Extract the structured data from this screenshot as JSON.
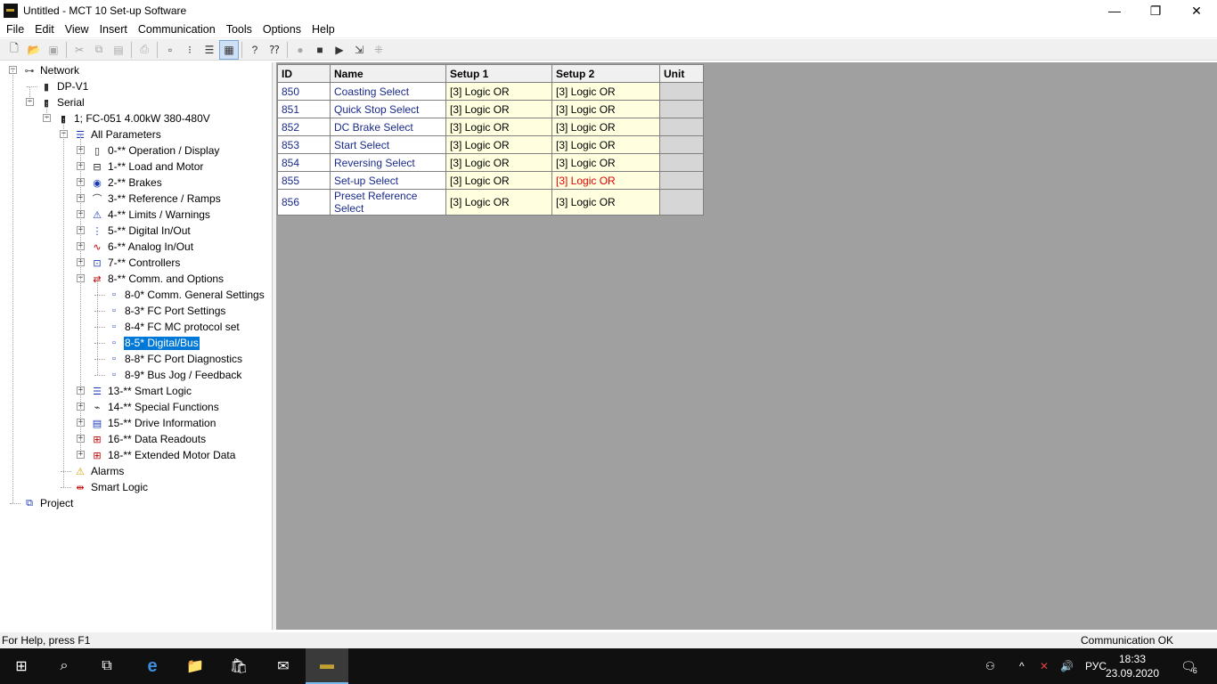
{
  "window": {
    "title": "Untitled - MCT 10 Set-up Software",
    "minimize_glyph": "—",
    "restore_glyph": "❐",
    "close_glyph": "✕"
  },
  "menu": [
    "File",
    "Edit",
    "View",
    "Insert",
    "Communication",
    "Tools",
    "Options",
    "Help"
  ],
  "toolbar": [
    {
      "icon": "new-file-icon",
      "glyph": "🗋",
      "disabled": false
    },
    {
      "icon": "open-folder-icon",
      "glyph": "📂",
      "disabled": false
    },
    {
      "icon": "save-icon",
      "glyph": "▣",
      "disabled": true
    },
    {
      "sep": true
    },
    {
      "icon": "cut-icon",
      "glyph": "✂",
      "disabled": true
    },
    {
      "icon": "copy-icon",
      "glyph": "⧉",
      "disabled": true
    },
    {
      "icon": "paste-icon",
      "glyph": "▤",
      "disabled": true
    },
    {
      "sep": true
    },
    {
      "icon": "print-icon",
      "glyph": "⎙",
      "disabled": true
    },
    {
      "sep": true
    },
    {
      "icon": "large-icons-view-icon",
      "glyph": "▫",
      "disabled": false
    },
    {
      "icon": "small-icons-view-icon",
      "glyph": "⁝",
      "disabled": false
    },
    {
      "icon": "list-view-icon",
      "glyph": "☰",
      "disabled": false
    },
    {
      "icon": "details-view-icon",
      "glyph": "▦",
      "disabled": false,
      "pressed": true
    },
    {
      "sep": true
    },
    {
      "icon": "help-icon",
      "glyph": "?",
      "disabled": false
    },
    {
      "icon": "context-help-icon",
      "glyph": "⁇",
      "disabled": false
    },
    {
      "sep": true
    },
    {
      "icon": "stop-icon",
      "glyph": "●",
      "disabled": true
    },
    {
      "icon": "drive-stop-icon",
      "glyph": "■",
      "disabled": false
    },
    {
      "icon": "drive-start-icon",
      "glyph": "▶",
      "disabled": false
    },
    {
      "icon": "read-from-drive-icon",
      "glyph": "⇲",
      "disabled": false
    },
    {
      "icon": "scan-network-icon",
      "glyph": "⁜",
      "disabled": true
    }
  ],
  "tree": [
    {
      "label": "Network",
      "level": 0,
      "icon": "network-icon",
      "glyph": "⊶",
      "color": "#555",
      "expander": "−"
    },
    {
      "label": "DP-V1",
      "level": 1,
      "icon": "drive-icon",
      "glyph": "▮",
      "color": "#333",
      "expander": ""
    },
    {
      "label": "Serial",
      "level": 1,
      "icon": "drive-icon",
      "glyph": "▮",
      "color": "#333",
      "expander": "−"
    },
    {
      "label": "1; FC-051 4.00kW 380-480V",
      "level": 2,
      "icon": "drive-icon",
      "glyph": "▮",
      "color": "#222",
      "expander": "−"
    },
    {
      "label": "All Parameters",
      "level": 3,
      "icon": "parameter-list-icon",
      "glyph": "☰",
      "color": "#1a3ab8",
      "expander": "−"
    },
    {
      "label": "0-** Operation / Display",
      "level": 4,
      "icon": "display-icon",
      "glyph": "▯",
      "color": "#222",
      "expander": "+"
    },
    {
      "label": "1-** Load and Motor",
      "level": 4,
      "icon": "motor-icon",
      "glyph": "⊟",
      "color": "#222",
      "expander": "+"
    },
    {
      "label": "2-** Brakes",
      "level": 4,
      "icon": "brake-icon",
      "glyph": "◉",
      "color": "#1a3ab8",
      "expander": "+"
    },
    {
      "label": "3-** Reference / Ramps",
      "level": 4,
      "icon": "ramp-icon",
      "glyph": "⌒",
      "color": "#333",
      "expander": "+"
    },
    {
      "label": "4-** Limits / Warnings",
      "level": 4,
      "icon": "limits-icon",
      "glyph": "⚠",
      "color": "#1a3ab8",
      "expander": "+"
    },
    {
      "label": "5-** Digital In/Out",
      "level": 4,
      "icon": "digital-io-icon",
      "glyph": "⋮",
      "color": "#1a3ab8",
      "expander": "+"
    },
    {
      "label": "6-** Analog In/Out",
      "level": 4,
      "icon": "analog-io-icon",
      "glyph": "∿",
      "color": "#c00000",
      "expander": "+"
    },
    {
      "label": "7-** Controllers",
      "level": 4,
      "icon": "controller-icon",
      "glyph": "⊡",
      "color": "#1a3ab8",
      "expander": "+"
    },
    {
      "label": "8-** Comm. and Options",
      "level": 4,
      "icon": "comm-icon",
      "glyph": "⇄",
      "color": "#c00000",
      "expander": "−"
    },
    {
      "label": "8-0* Comm. General Settings",
      "level": 5,
      "icon": "param-group-icon",
      "glyph": "▫",
      "color": "#1a3ab8",
      "expander": ""
    },
    {
      "label": "8-3* FC Port Settings",
      "level": 5,
      "icon": "param-group-icon",
      "glyph": "▫",
      "color": "#1a3ab8",
      "expander": ""
    },
    {
      "label": "8-4* FC MC protocol set",
      "level": 5,
      "icon": "param-group-icon",
      "glyph": "▫",
      "color": "#1a3ab8",
      "expander": ""
    },
    {
      "label": "8-5* Digital/Bus",
      "level": 5,
      "icon": "param-group-icon",
      "glyph": "▫",
      "color": "#1a3ab8",
      "expander": "",
      "selected": true
    },
    {
      "label": "8-8* FC Port Diagnostics",
      "level": 5,
      "icon": "param-group-icon",
      "glyph": "▫",
      "color": "#1a3ab8",
      "expander": ""
    },
    {
      "label": "8-9* Bus Jog / Feedback",
      "level": 5,
      "icon": "param-group-icon",
      "glyph": "▫",
      "color": "#1a3ab8",
      "expander": ""
    },
    {
      "label": "13-** Smart Logic",
      "level": 4,
      "icon": "smart-logic-icon",
      "glyph": "☰",
      "color": "#1a3ab8",
      "expander": "+"
    },
    {
      "label": "14-** Special Functions",
      "level": 4,
      "icon": "special-functions-icon",
      "glyph": "⌁",
      "color": "#333",
      "expander": "+"
    },
    {
      "label": "15-** Drive Information",
      "level": 4,
      "icon": "drive-info-icon",
      "glyph": "▤",
      "color": "#1a3ab8",
      "expander": "+"
    },
    {
      "label": "16-** Data Readouts",
      "level": 4,
      "icon": "data-readouts-icon",
      "glyph": "⊞",
      "color": "#c00000",
      "expander": "+"
    },
    {
      "label": "18-** Extended Motor Data",
      "level": 4,
      "icon": "extended-motor-icon",
      "glyph": "⊞",
      "color": "#c00000",
      "expander": "+"
    },
    {
      "label": "Alarms",
      "level": 3,
      "icon": "alarm-icon",
      "glyph": "⚠",
      "color": "#d4a000",
      "expander": ""
    },
    {
      "label": "Smart Logic",
      "level": 3,
      "icon": "smart-logic-icon",
      "glyph": "⇹",
      "color": "#c00000",
      "expander": ""
    },
    {
      "label": "Project",
      "level": 0,
      "icon": "project-icon",
      "glyph": "⧉",
      "color": "#1a3ab8",
      "expander": ""
    }
  ],
  "grid": {
    "columns": [
      "ID",
      "Name",
      "Setup 1",
      "Setup 2",
      "Unit"
    ],
    "rows": [
      {
        "id": "850",
        "name": "Coasting Select",
        "setup1": "[3] Logic OR",
        "setup2": "[3] Logic OR",
        "unit": "",
        "differs": false
      },
      {
        "id": "851",
        "name": "Quick Stop Select",
        "setup1": "[3] Logic OR",
        "setup2": "[3] Logic OR",
        "unit": "",
        "differs": false
      },
      {
        "id": "852",
        "name": "DC Brake Select",
        "setup1": "[3] Logic OR",
        "setup2": "[3] Logic OR",
        "unit": "",
        "differs": false
      },
      {
        "id": "853",
        "name": "Start Select",
        "setup1": "[3] Logic OR",
        "setup2": "[3] Logic OR",
        "unit": "",
        "differs": false
      },
      {
        "id": "854",
        "name": "Reversing Select",
        "setup1": "[3] Logic OR",
        "setup2": "[3] Logic OR",
        "unit": "",
        "differs": false
      },
      {
        "id": "855",
        "name": "Set-up Select",
        "setup1": "[3] Logic OR",
        "setup2": "[3] Logic OR",
        "unit": "",
        "differs": true
      },
      {
        "id": "856",
        "name": "Preset Reference Select",
        "setup1": "[3] Logic OR",
        "setup2": "[3] Logic OR",
        "unit": "",
        "differs": false
      }
    ]
  },
  "status": {
    "help": "For Help, press F1",
    "communication": "Communication OK"
  },
  "taskbar": {
    "apps": [
      {
        "icon": "windows-start-icon",
        "glyph": "⊞"
      },
      {
        "icon": "search-icon",
        "glyph": "⌕"
      },
      {
        "icon": "task-view-icon",
        "glyph": "⧉"
      },
      {
        "icon": "edge-browser-icon",
        "glyph": "e"
      },
      {
        "icon": "file-explorer-icon",
        "glyph": "📁"
      },
      {
        "icon": "store-icon",
        "glyph": "🛍"
      },
      {
        "icon": "mail-icon",
        "glyph": "✉"
      },
      {
        "icon": "mct10-app-icon",
        "glyph": "▬",
        "active": true
      }
    ],
    "tray": {
      "people_glyph": "⚇",
      "chevron_glyph": "^",
      "network_glyph": "✕",
      "volume_glyph": "🔊",
      "language": "РУС",
      "time": "18:33",
      "date": "23.09.2020",
      "notifications_glyph": "🗨",
      "notification_count": "6"
    }
  }
}
